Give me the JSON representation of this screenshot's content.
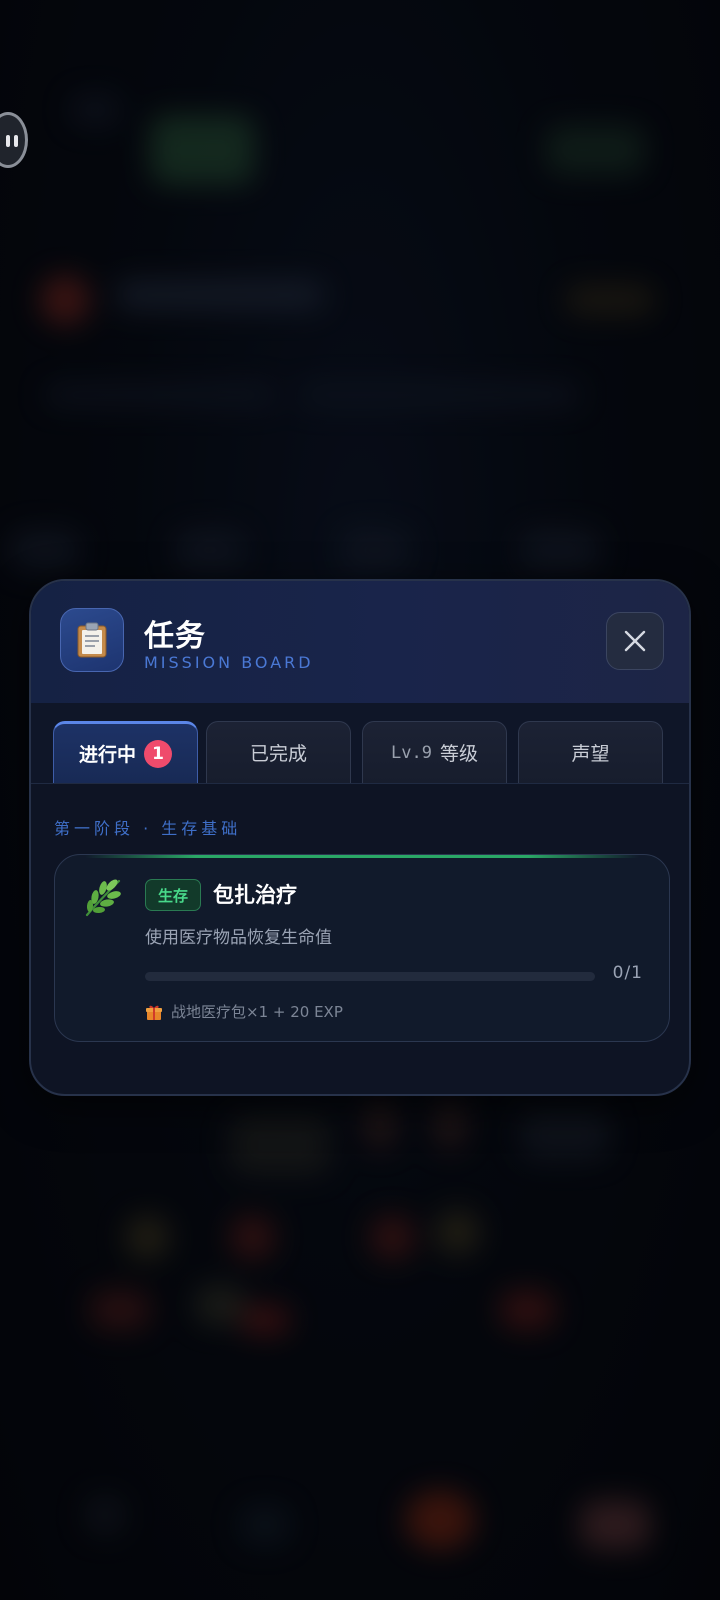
{
  "modal": {
    "title": "任务",
    "subtitle": "MISSION BOARD",
    "header_icon": "clipboard-icon",
    "close_icon": "close-icon"
  },
  "tabs": [
    {
      "label": "进行中",
      "badge": "1",
      "active": true
    },
    {
      "label": "已完成",
      "active": false
    },
    {
      "prefix": "Lv.9",
      "label": "等级",
      "active": false
    },
    {
      "label": "声望",
      "active": false
    }
  ],
  "section": {
    "label": "第一阶段 · 生存基础"
  },
  "task": {
    "icon": "herb-icon",
    "tag": "生存",
    "name": "包扎治疗",
    "description": "使用医疗物品恢复生命值",
    "progress_text": "0/1",
    "progress_fraction": 0,
    "reward_icon": "gift-icon",
    "reward": "战地医疗包×1 + 20 EXP"
  },
  "colors": {
    "accent_blue": "#4a78d4",
    "badge_red": "#ef4b6c",
    "tag_green": "#48d98a",
    "modal_bg": "#0e1424"
  }
}
